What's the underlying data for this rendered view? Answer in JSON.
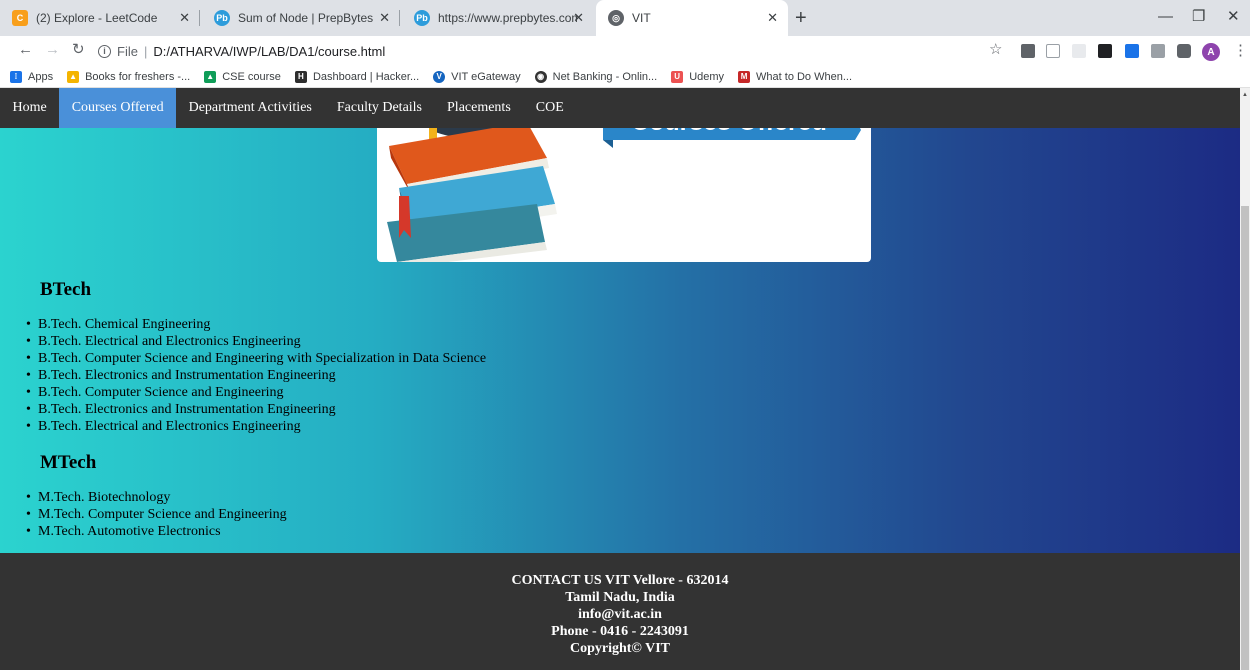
{
  "browser": {
    "tabs": [
      {
        "title": "(2) Explore - LeetCode",
        "favicon": "leetcode-icon"
      },
      {
        "title": "Sum of Node | PrepBytes",
        "favicon": "prepbytes-icon"
      },
      {
        "title": "https://www.prepbytes.com/pane",
        "favicon": "prepbytes-icon"
      },
      {
        "title": "VIT",
        "favicon": "globe-icon"
      }
    ],
    "address": {
      "scheme": "File",
      "path": "D:/ATHARVA/IWP/LAB/DA1/course.html"
    },
    "profile_initial": "A",
    "bookmarks": [
      {
        "label": "Apps",
        "icon": "apps-grid-icon",
        "color": "#1a73e8"
      },
      {
        "label": "Books for freshers -...",
        "icon": "google-drive-icon",
        "color": "#f4b400"
      },
      {
        "label": "CSE course",
        "icon": "google-drive-icon",
        "color": "#0f9d58"
      },
      {
        "label": "Dashboard | Hacker...",
        "icon": "hackerearth-icon",
        "color": "#2e2e2e"
      },
      {
        "label": "VIT eGateway",
        "icon": "vit-icon",
        "color": "#1565c0"
      },
      {
        "label": "Net Banking - Onlin...",
        "icon": "bank-icon",
        "color": "#333333"
      },
      {
        "label": "Udemy",
        "icon": "udemy-icon",
        "color": "#ec5252"
      },
      {
        "label": "What to Do When...",
        "icon": "mt-icon",
        "color": "#c62828"
      }
    ]
  },
  "site": {
    "nav": [
      {
        "label": "Home",
        "active": false
      },
      {
        "label": "Courses Offered",
        "active": true
      },
      {
        "label": "Department Activities",
        "active": false
      },
      {
        "label": "Faculty Details",
        "active": false
      },
      {
        "label": "Placements",
        "active": false
      },
      {
        "label": "COE",
        "active": false
      }
    ],
    "banner_text": "Courses Offered",
    "btech": {
      "title": "BTech",
      "courses": [
        "B.Tech. Chemical Engineering",
        "B.Tech. Electrical and Electronics Engineering",
        "B.Tech. Computer Science and Engineering with Specialization in Data Science",
        "B.Tech. Electronics and Instrumentation Engineering",
        "B.Tech. Computer Science and Engineering",
        "B.Tech. Electronics and Instrumentation Engineering",
        "B.Tech. Electrical and Electronics Engineering"
      ]
    },
    "mtech": {
      "title": "MTech",
      "courses": [
        "M.Tech. Biotechnology",
        "M.Tech. Computer Science and Engineering",
        "M.Tech. Automotive Electronics"
      ]
    },
    "footer": {
      "line1": "CONTACT US VIT Vellore - 632014",
      "line2": "Tamil Nadu, India",
      "line3": "info@vit.ac.in",
      "line4": "Phone - 0416 - 2243091",
      "line5": "Copyright© VIT"
    },
    "colors": {
      "nav_bg": "#333333",
      "nav_active": "#4a90d9",
      "gradient_start": "#2bd3cf",
      "gradient_end": "#1c2b84"
    }
  }
}
